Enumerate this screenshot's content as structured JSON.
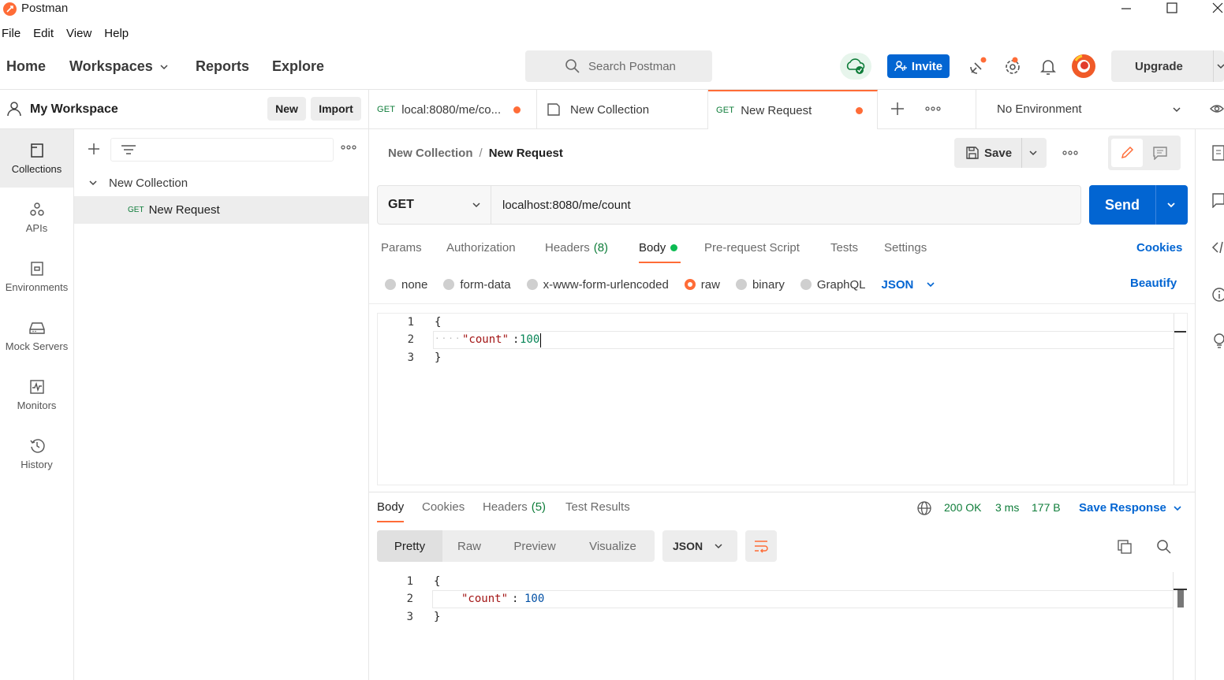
{
  "window": {
    "title": "Postman"
  },
  "menu": [
    "File",
    "Edit",
    "View",
    "Help"
  ],
  "nav": {
    "home": "Home",
    "workspaces": "Workspaces",
    "reports": "Reports",
    "explore": "Explore"
  },
  "search": {
    "placeholder": "Search Postman"
  },
  "header": {
    "invite": "Invite",
    "upgrade": "Upgrade"
  },
  "workspace": {
    "name": "My Workspace",
    "new": "New",
    "import": "Import"
  },
  "rail": [
    {
      "label": "Collections",
      "icon": "collections-icon"
    },
    {
      "label": "APIs",
      "icon": "apis-icon"
    },
    {
      "label": "Environments",
      "icon": "environments-icon"
    },
    {
      "label": "Mock Servers",
      "icon": "mock-servers-icon"
    },
    {
      "label": "Monitors",
      "icon": "monitors-icon"
    },
    {
      "label": "History",
      "icon": "history-icon"
    }
  ],
  "tree": {
    "collection": "New Collection",
    "request_method": "GET",
    "request": "New Request"
  },
  "tabs": [
    {
      "method": "GET",
      "label": "local:8080/me/co..."
    },
    {
      "label": "New Collection"
    },
    {
      "method": "GET",
      "label": "New Request"
    }
  ],
  "environment": "No Environment",
  "breadcrumb": {
    "collection": "New Collection",
    "sep": "/",
    "request": "New Request"
  },
  "actions": {
    "save": "Save"
  },
  "request": {
    "method": "GET",
    "url": "localhost:8080/me/count",
    "send": "Send"
  },
  "req_tabs": {
    "params": "Params",
    "authorization": "Authorization",
    "headers": "Headers",
    "headers_count": "(8)",
    "body": "Body",
    "prerequest": "Pre-request Script",
    "tests": "Tests",
    "settings": "Settings",
    "cookies": "Cookies"
  },
  "body_types": {
    "none": "none",
    "formdata": "form-data",
    "urlencoded": "x-www-form-urlencoded",
    "raw": "raw",
    "binary": "binary",
    "graphql": "GraphQL",
    "format": "JSON",
    "beautify": "Beautify"
  },
  "request_body": {
    "lines": [
      "1",
      "2",
      "3"
    ],
    "open": "{",
    "key": "\"count\"",
    "colon": ":",
    "value": "100",
    "close": "}"
  },
  "response": {
    "tabs": {
      "body": "Body",
      "cookies": "Cookies",
      "headers": "Headers",
      "headers_count": "(5)",
      "test_results": "Test Results"
    },
    "status": "200 OK",
    "time": "3 ms",
    "size": "177 B",
    "save_response": "Save Response",
    "views": {
      "pretty": "Pretty",
      "raw": "Raw",
      "preview": "Preview",
      "visualize": "Visualize"
    },
    "format": "JSON",
    "body": {
      "lines": [
        "1",
        "2",
        "3"
      ],
      "open": "{",
      "key": "\"count\"",
      "colon": ": ",
      "value": "100",
      "close": "}"
    }
  },
  "colors": {
    "accent": "#ff6c37",
    "primary": "#0265d2",
    "get": "#0f7d3a",
    "status_ok": "#0f7d3a"
  }
}
